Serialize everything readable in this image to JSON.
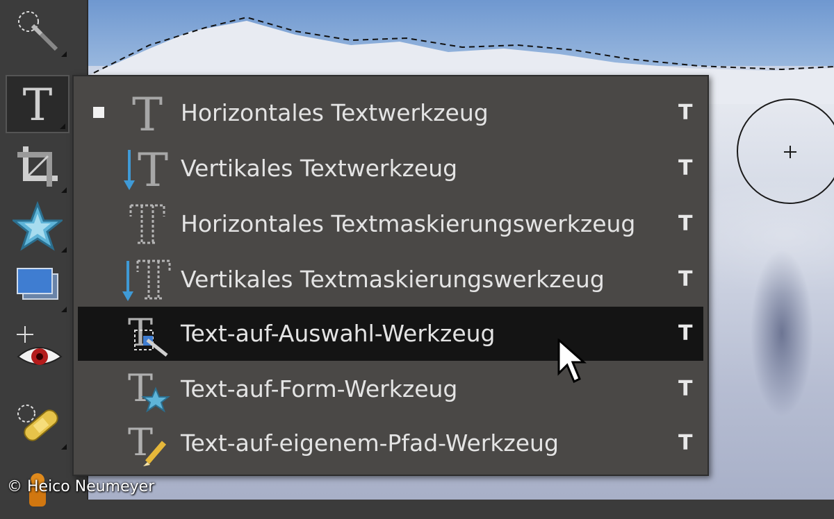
{
  "menu": {
    "items": [
      {
        "label": "Horizontales Textwerkzeug",
        "shortcut": "T",
        "icon": "horizontal-type-icon",
        "selected": true
      },
      {
        "label": "Vertikales Textwerkzeug",
        "shortcut": "T",
        "icon": "vertical-type-icon",
        "selected": false
      },
      {
        "label": "Horizontales Textmaskierungswerkzeug",
        "shortcut": "T",
        "icon": "horizontal-type-mask-icon",
        "selected": false
      },
      {
        "label": "Vertikales Textmaskierungswerkzeug",
        "shortcut": "T",
        "icon": "vertical-type-mask-icon",
        "selected": false
      },
      {
        "label": "Text-auf-Auswahl-Werkzeug",
        "shortcut": "T",
        "icon": "text-on-selection-icon",
        "selected": false,
        "hovered": true
      },
      {
        "label": "Text-auf-Form-Werkzeug",
        "shortcut": "T",
        "icon": "text-on-shape-icon",
        "selected": false
      },
      {
        "label": "Text-auf-eigenem-Pfad-Werkzeug",
        "shortcut": "T",
        "icon": "text-on-path-icon",
        "selected": false
      }
    ]
  },
  "toolbar": {
    "tools": [
      "quick-selection-icon",
      "type-tool-icon",
      "crop-icon",
      "custom-shape-icon",
      "recompose-icon",
      "red-eye-icon",
      "healing-brush-icon",
      "clone-stamp-icon"
    ],
    "active": "type-tool-icon"
  },
  "credit": "© Heico Neumeyer",
  "colors": {
    "menu_bg": "#4a4846",
    "highlight_bg": "#141414",
    "text": "#e4e4e4",
    "toolbar_bg": "#3c3c3c"
  }
}
